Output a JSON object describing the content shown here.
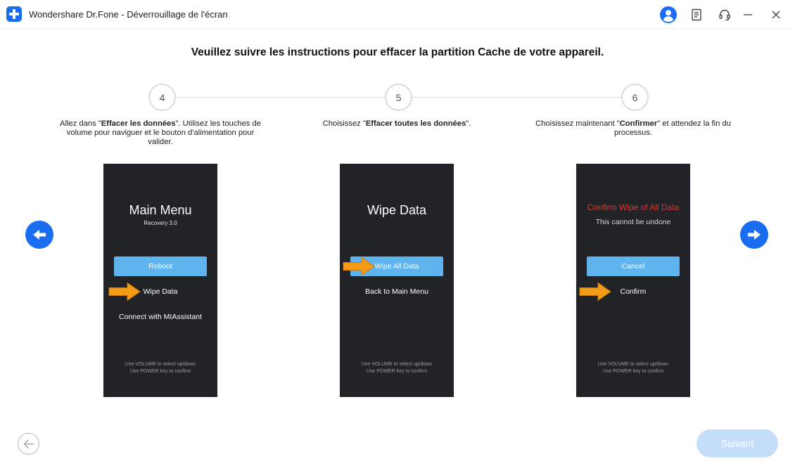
{
  "window": {
    "title": "Wondershare Dr.Fone - Déverrouillage de l'écran"
  },
  "titlebar_icons": [
    "account-icon",
    "feedback-icon",
    "support-headset-icon",
    "minimize-icon",
    "close-icon"
  ],
  "heading": "Veuillez suivre les instructions pour effacer la partition Cache de votre appareil.",
  "steps": [
    {
      "number": "4",
      "desc_pre": "Allez dans \"",
      "desc_bold": "Effacer les données",
      "desc_post": "\". Utilisez les touches de volume pour naviguer et le bouton d'alimentation pour valider.",
      "phone": {
        "title": "Main Menu",
        "subtitle": "Recovery 3.0",
        "button": "Reboot",
        "items": [
          "Wipe Data",
          "Connect with MIAssistant"
        ],
        "footer": [
          "Use VOLUME to select up/down",
          "Use POWER key to confirm"
        ]
      }
    },
    {
      "number": "5",
      "desc_pre": "Choisissez \"",
      "desc_bold": "Effacer toutes les données",
      "desc_post": "\".",
      "phone": {
        "title": "Wipe Data",
        "button": "Wipe All Data",
        "items": [
          "Back to Main Menu"
        ],
        "footer": [
          "Use VOLUME to select up/down",
          "Use POWER key to confirm"
        ]
      }
    },
    {
      "number": "6",
      "desc_pre": "Choisissez maintenant \"",
      "desc_bold": "Confirmer",
      "desc_post": "\" et attendez la fin du processus.",
      "phone": {
        "warning": "Confirm Wipe of All Data",
        "note": "This cannot be undone",
        "button": "Cancel",
        "items": [
          "Confirm"
        ],
        "footer": [
          "Use VOLUME to select up/down",
          "Use POWER key to confirm"
        ]
      }
    }
  ],
  "navigation": {
    "prev_icon": "arrow-left-icon",
    "next_icon": "arrow-right-icon"
  },
  "footer": {
    "back_icon": "back-arrow-icon",
    "next_label": "Suivant",
    "next_enabled": false
  },
  "colors": {
    "accent": "#1a6cf0",
    "phone_bg": "#222327",
    "phone_button": "#5fb4ee",
    "highlight_arrow": "#f39a17",
    "warning_red": "#e2322c",
    "disabled_button": "#c5defa"
  }
}
